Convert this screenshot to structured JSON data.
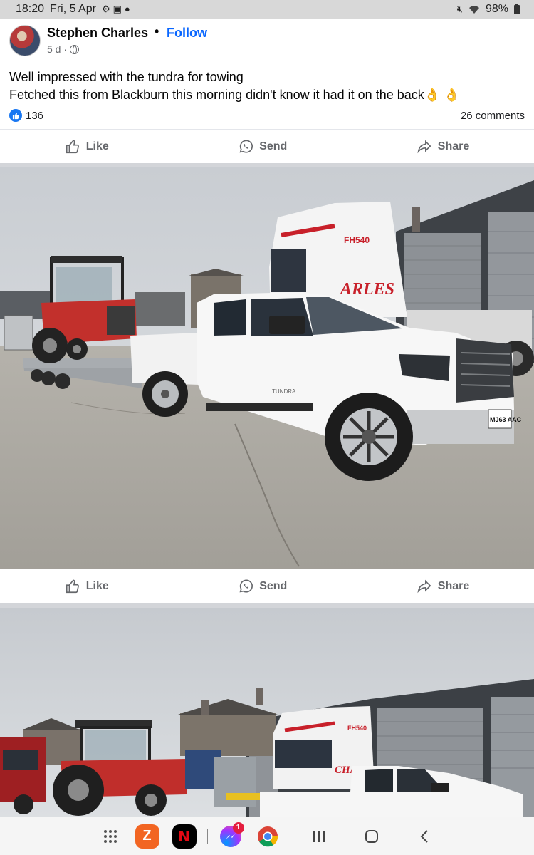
{
  "status_bar": {
    "time": "18:20",
    "date": "Fri, 5 Apr",
    "battery": "98%"
  },
  "post": {
    "author": "Stephen Charles",
    "follow_label": "Follow",
    "separator": "•",
    "age": "5 d ·",
    "text_line1": "Well impressed with the tundra for towing",
    "text_line2": "Fetched this from Blackburn this morning didn't know it had it on the back",
    "text_emoji": "👌 👌",
    "like_count": "136",
    "comments": "26 comments"
  },
  "actions": {
    "like": "Like",
    "send": "Send",
    "share": "Share"
  },
  "photo1": {
    "truck_text": "ARLES",
    "cab_number": "FH540",
    "plate": "MJ63 AAC",
    "badge": "TUNDRA"
  },
  "photo2": {
    "truck_text": "CHARLES",
    "cab_number": "FH540"
  },
  "nav": {
    "messenger_badge": "1"
  },
  "colors": {
    "facebook_blue": "#0866ff",
    "meta_gray": "#65676b",
    "separator_gray": "#d3d5d9"
  }
}
